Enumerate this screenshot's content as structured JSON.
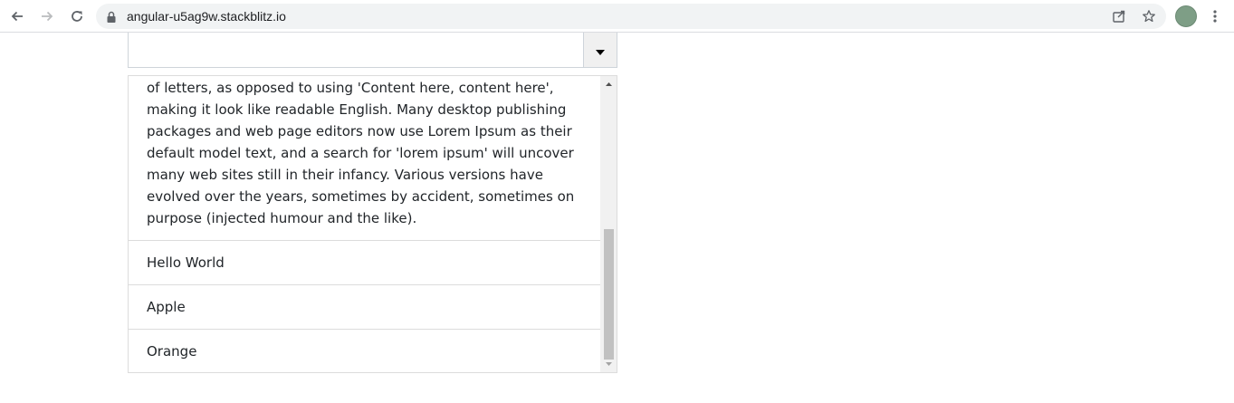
{
  "browser": {
    "url": "angular-u5ag9w.stackblitz.io",
    "icons": [
      "back-arrow-icon",
      "forward-arrow-icon",
      "reload-icon",
      "lock-icon",
      "share-icon",
      "star-icon",
      "avatar",
      "more-vert-icon"
    ]
  },
  "dropdown": {
    "value": "",
    "toggle_icon": "caret-down-icon"
  },
  "options": [
    {
      "label": "of letters, as opposed to using 'Content here, content here', making it look like readable English. Many desktop publishing packages and web page editors now use Lorem Ipsum as their default model text, and a search for 'lorem ipsum' will uncover many web sites still in their infancy. Various versions have evolved over the years, sometimes by accident, sometimes on purpose (injected humour and the like)."
    },
    {
      "label": "Hello World"
    },
    {
      "label": "Apple"
    },
    {
      "label": "Orange"
    }
  ],
  "colors": {
    "border": "#ced4da",
    "scroll_thumb": "#c1c1c1",
    "text": "#212529"
  }
}
